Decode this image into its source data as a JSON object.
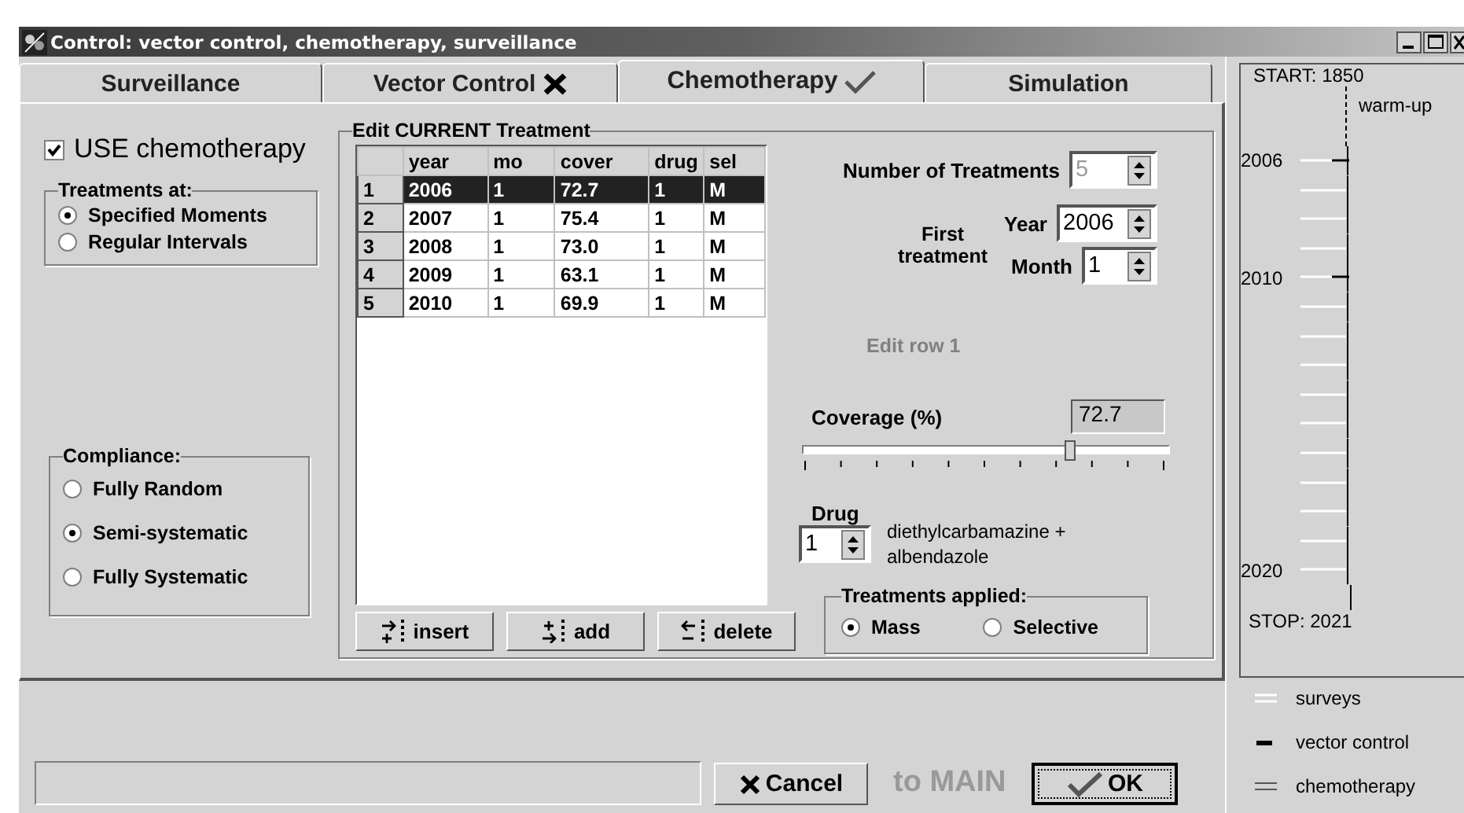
{
  "window": {
    "title": "Control: vector control, chemotherapy, surveillance"
  },
  "tabs": [
    {
      "label": "Surveillance",
      "selected": false
    },
    {
      "label": "Vector Control",
      "selected": false,
      "kind": "cross"
    },
    {
      "label": "Chemotherapy",
      "selected": true,
      "kind": "check"
    },
    {
      "label": "Simulation",
      "selected": false
    }
  ],
  "use_checkbox": {
    "label": "USE chemotherapy",
    "checked": true
  },
  "treatments_at": {
    "title": "Treatments at:",
    "options": [
      {
        "label": "Specified Moments",
        "selected": true
      },
      {
        "label": "Regular Intervals",
        "selected": false
      }
    ]
  },
  "compliance": {
    "title": "Compliance:",
    "options": [
      {
        "label": "Fully Random",
        "selected": false
      },
      {
        "label": "Semi-systematic",
        "selected": true
      },
      {
        "label": "Fully Systematic",
        "selected": false
      }
    ]
  },
  "edit_group": {
    "title": "Edit CURRENT Treatment",
    "table": {
      "columns": [
        "year",
        "mo",
        "cover",
        "drug",
        "sel"
      ],
      "rows": [
        {
          "index": "1",
          "cells": [
            "2006",
            "1",
            "72.7",
            "1",
            "M"
          ],
          "selected": true
        },
        {
          "index": "2",
          "cells": [
            "2007",
            "1",
            "75.4",
            "1",
            "M"
          ],
          "selected": false
        },
        {
          "index": "3",
          "cells": [
            "2008",
            "1",
            "73.0",
            "1",
            "M"
          ],
          "selected": false
        },
        {
          "index": "4",
          "cells": [
            "2009",
            "1",
            "63.1",
            "1",
            "M"
          ],
          "selected": false
        },
        {
          "index": "5",
          "cells": [
            "2010",
            "1",
            "69.9",
            "1",
            "M"
          ],
          "selected": false
        }
      ]
    },
    "buttons": [
      {
        "label": "insert",
        "kind": "insert"
      },
      {
        "label": "add",
        "kind": "add"
      },
      {
        "label": "delete",
        "kind": "delete"
      }
    ],
    "number_of_treatments": {
      "label": "Number of Treatments",
      "value": "5",
      "disabled": true
    },
    "first_treatment": {
      "label": "First treatment",
      "year_label": "Year",
      "year": "2006",
      "month_label": "Month",
      "month": "1"
    },
    "edit_row": "Edit row 1",
    "coverage": {
      "label": "Coverage (%)",
      "value": "72.7",
      "level": 0.727
    },
    "drug": {
      "label": "Drug",
      "value": "1",
      "name": "diethylcarbamazine + albendazole"
    },
    "treatments_applied": {
      "title": "Treatments applied:",
      "options": [
        {
          "label": "Mass",
          "selected": true
        },
        {
          "label": "Selective",
          "selected": false
        }
      ]
    }
  },
  "bottom": {
    "cancel": "Cancel",
    "to_main": "to MAIN",
    "ok": "OK"
  },
  "timeline": {
    "start": "START: 1850",
    "warmup": "warm-up",
    "stop": "STOP: 2021",
    "ticks": [
      {
        "label": "2006",
        "marked": true
      },
      {
        "marked": false
      },
      {
        "marked": false
      },
      {
        "marked": false
      },
      {
        "label": "2010",
        "marked": true
      },
      {
        "marked": false
      },
      {
        "marked": false
      },
      {
        "marked": false
      },
      {
        "marked": false
      },
      {
        "marked": false
      },
      {
        "marked": false
      },
      {
        "marked": false
      },
      {
        "marked": false
      },
      {
        "marked": false
      },
      {
        "label": "2020",
        "marked": false
      }
    ],
    "legend": [
      {
        "label": "surveys",
        "kind": "light"
      },
      {
        "label": "vector control",
        "kind": "dark"
      },
      {
        "label": "chemotherapy",
        "kind": "grey"
      }
    ]
  }
}
